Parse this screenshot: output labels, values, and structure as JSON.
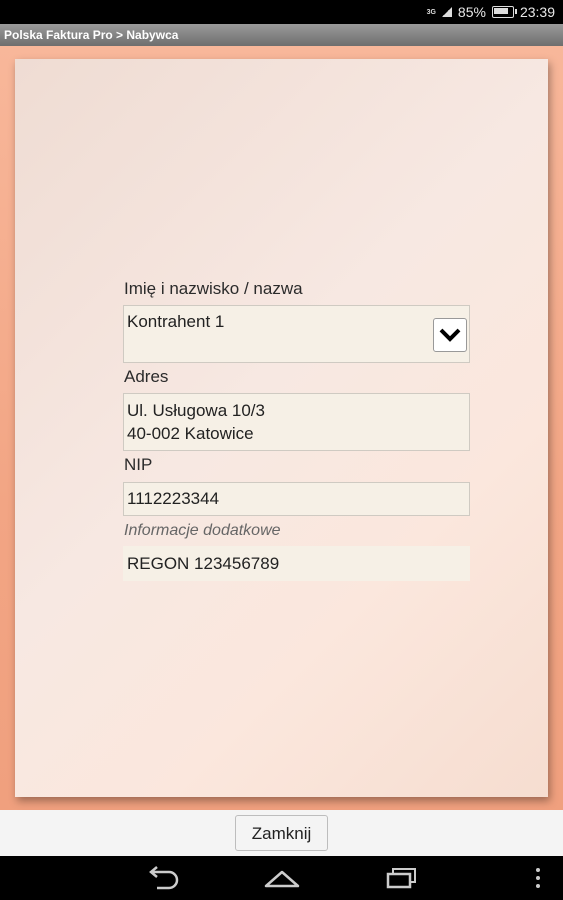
{
  "status_bar": {
    "signal_label": "3G",
    "battery_percent": "85%",
    "time": "23:39"
  },
  "title_bar": {
    "title": "Polska Faktura Pro > Nabywca"
  },
  "form": {
    "name_label": "Imię i nazwisko / nazwa",
    "name_value": "Kontrahent 1",
    "address_label": "Adres",
    "address_line1": "Ul. Usługowa 10/3",
    "address_line2": "40-002 Katowice",
    "nip_label": "NIP",
    "nip_value": "1112223344",
    "extra_label": "Informacje dodatkowe",
    "extra_value": "REGON 123456789"
  },
  "bottom_bar": {
    "close_label": "Zamknij"
  },
  "nav_bar": {
    "icons": [
      "back-icon",
      "home-icon",
      "recent-apps-icon",
      "menu-icon"
    ]
  }
}
